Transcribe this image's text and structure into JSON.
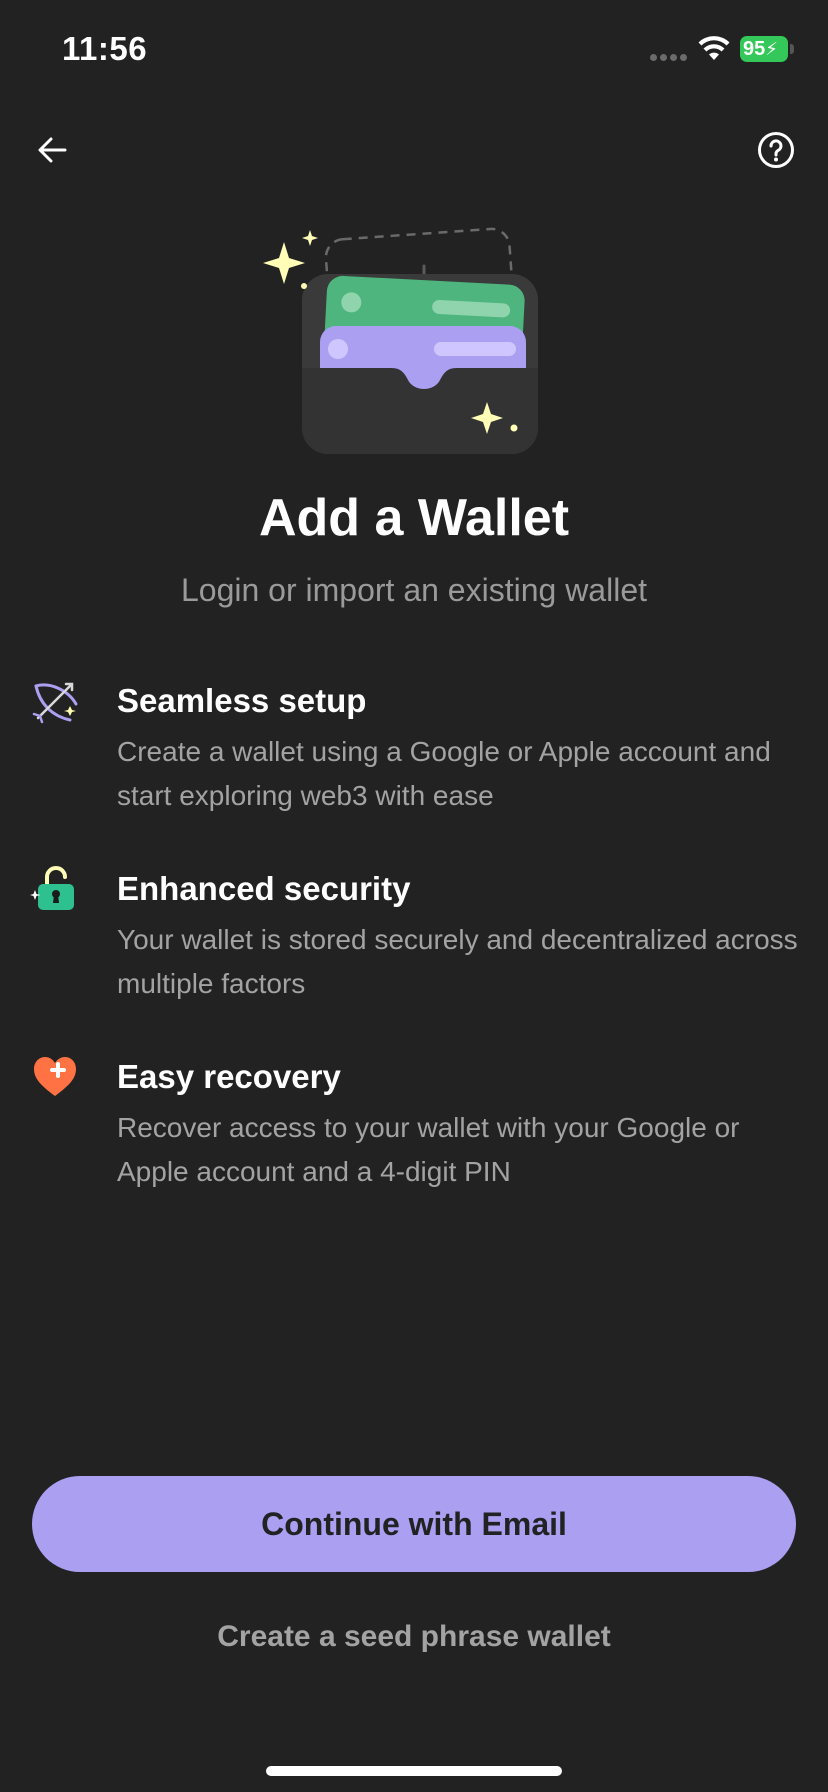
{
  "status_bar": {
    "time": "11:56",
    "battery_level": "95"
  },
  "nav": {
    "back_icon": "arrow-left-icon",
    "help_icon": "question-circle-icon"
  },
  "header": {
    "title": "Add a Wallet",
    "subtitle": "Login or import an existing wallet"
  },
  "features": [
    {
      "icon": "bow-arrow-icon",
      "title": "Seamless setup",
      "description": "Create a wallet using a Google or Apple account and start exploring web3 with ease"
    },
    {
      "icon": "padlock-icon",
      "title": "Enhanced security",
      "description": "Your wallet is stored securely and decentralized across multiple factors"
    },
    {
      "icon": "heart-plus-icon",
      "title": "Easy recovery",
      "description": "Recover access to your wallet with your Google or Apple account and a 4-digit PIN"
    }
  ],
  "actions": {
    "primary_label": "Continue with Email",
    "secondary_label": "Create a seed phrase wallet"
  },
  "colors": {
    "background": "#222222",
    "accent": "#ab9ff2",
    "muted_text": "#a3a3a3",
    "green_card": "#4fb57e",
    "security_green": "#2ec08e",
    "heart_orange": "#ff7243",
    "sparkle": "#fffdb6"
  }
}
